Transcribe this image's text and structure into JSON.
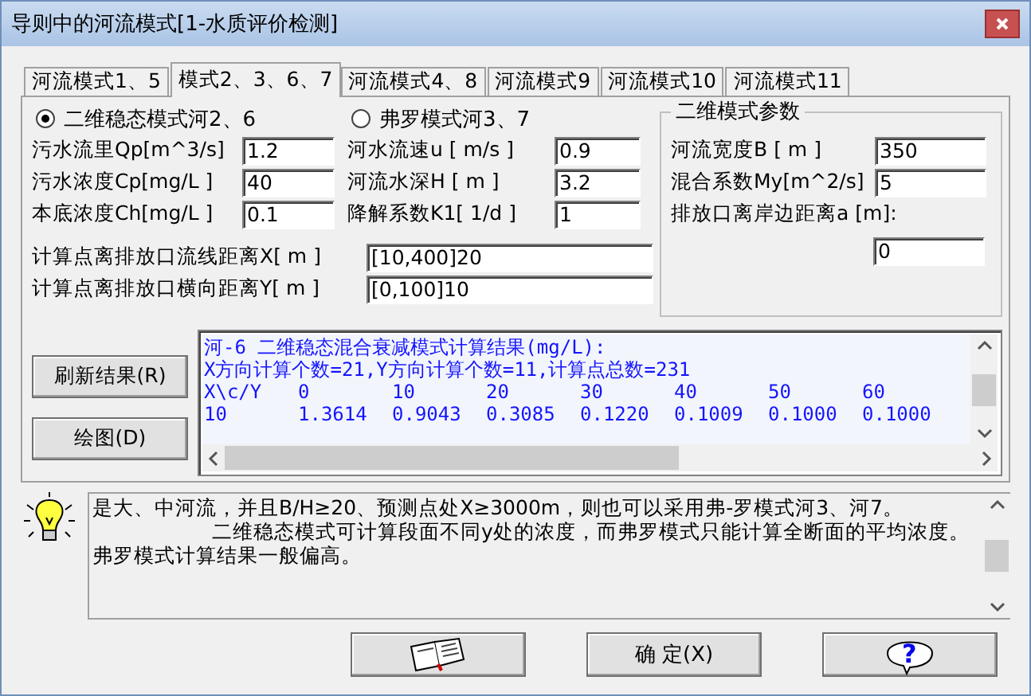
{
  "window": {
    "title": "导则中的河流模式[1-水质评价检测]"
  },
  "tabs": [
    {
      "label": "河流模式1、5",
      "selected": false
    },
    {
      "label": "模式2、3、6、7",
      "selected": true
    },
    {
      "label": "河流模式4、8",
      "selected": false
    },
    {
      "label": "河流模式9",
      "selected": false
    },
    {
      "label": "河流模式10",
      "selected": false
    },
    {
      "label": "河流模式11",
      "selected": false
    }
  ],
  "columns": [
    {
      "radio": {
        "label": "二维稳态模式河2、6",
        "selected": true
      },
      "fields": [
        {
          "label": "污水流里Qp[m^3/s]",
          "value": "1.2"
        },
        {
          "label": "污水浓度Cp[mg/L ]",
          "value": "40"
        },
        {
          "label": "本底浓度Ch[mg/L ]",
          "value": "0.1"
        }
      ]
    },
    {
      "radio": {
        "label": "弗罗模式河3、7",
        "selected": false
      },
      "fields": [
        {
          "label": "河水流速u [ m/s ]",
          "value": "0.9"
        },
        {
          "label": "河流水深H [ m  ]",
          "value": "3.2"
        },
        {
          "label": "降解系数K1[ 1/d ]",
          "value": "1"
        }
      ]
    }
  ],
  "distances": [
    {
      "label": "计算点离排放口流线距离X[ m ]",
      "value": "[10,400]20"
    },
    {
      "label": "计算点离排放口横向距离Y[ m ]",
      "value": "[0,100]10"
    }
  ],
  "params": {
    "title": "二维模式参数",
    "fields": [
      {
        "label": "河流宽度B [ m  ]",
        "value": "350"
      },
      {
        "label": "混合系数My[m^2/s]",
        "value": "5"
      }
    ],
    "offset": {
      "label": "排放口离岸边距离a [m]:",
      "value": "0"
    }
  },
  "actions": [
    "刷新结果(R)",
    "绘图(D)"
  ],
  "results": {
    "lines": [
      "河-6 二维稳态混合衰减模式计算结果(mg/L):",
      "X方向计算个数=21,Y方向计算个数=11,计算点总数=231"
    ],
    "columns": [
      "X\\c/Y",
      "0",
      "10",
      "20",
      "30",
      "40",
      "50",
      "60"
    ],
    "rows": [
      [
        "10",
        "1.3614",
        "0.9043",
        "0.3085",
        "0.1220",
        "0.1009",
        "0.1000",
        "0.1000"
      ]
    ]
  },
  "hint": {
    "paragraphs": [
      "是大、中河流，并且B/H≥20、预测点处X≥3000m，则也可以采用弗-罗模式河3、河7。",
      "二维稳态模式可计算段面不同y处的浓度，而弗罗模式只能计算全断面的平均浓度。弗罗模式计算结果一般偏高。"
    ]
  },
  "footer": [
    {
      "kind": "book"
    },
    {
      "kind": "text",
      "label": "确 定(X)"
    },
    {
      "kind": "help",
      "label": "?"
    }
  ]
}
